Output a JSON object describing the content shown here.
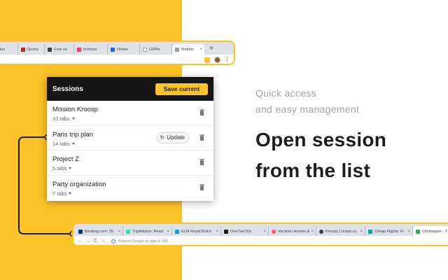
{
  "top_browser": {
    "tabs": [
      {
        "label": "dun",
        "fav_color": "#d9d9d9"
      },
      {
        "label": "Quora",
        "fav_color": "#b92b27"
      },
      {
        "label": "Free ve",
        "fav_color": "#3c4043"
      },
      {
        "label": "InVision",
        "fav_color": "#ff3366"
      },
      {
        "label": "Online",
        "fav_color": "#2b62d9"
      },
      {
        "label": "UXPin",
        "fav_color": "#9aa0a6"
      },
      {
        "label": "Mobbin",
        "fav_color": "#9aa0a6"
      }
    ],
    "new_tab_label": "+",
    "menu_glyph": "⋮"
  },
  "popup": {
    "title": "Sessions",
    "save_label": "Save current",
    "update_label": "Update",
    "sessions": [
      {
        "name": "Mission Kroosp",
        "tabs": "10 tabs"
      },
      {
        "name": "Paris trip plan",
        "tabs": "14 tabs"
      },
      {
        "name": "Project Z",
        "tabs": "5 tabs"
      },
      {
        "name": "Party organization",
        "tabs": "7 tabs"
      }
    ]
  },
  "hero": {
    "subtitle_line1": "Quick access",
    "subtitle_line2": "and easy management",
    "heading_line1": "Open session",
    "heading_line2": "from the list"
  },
  "bottom_browser": {
    "tabs": [
      {
        "label": "Booking.com: 25",
        "fav_color": "#003580"
      },
      {
        "label": "TripAdvisor: Read",
        "fav_color": "#34e0a1"
      },
      {
        "label": "KLM Royal Dutch",
        "fav_color": "#00a1de"
      },
      {
        "label": "OneTwoTrip",
        "fav_color": "#1a1a1a"
      },
      {
        "label": "Vacation Homes &",
        "fav_color": "#ff5a5f"
      },
      {
        "label": "Kroosp | Urban ca",
        "fav_color": "#3c4043"
      },
      {
        "label": "Cheap Flights: Fi",
        "fav_color": "#00a698"
      },
      {
        "label": "Citymapper - T",
        "fav_color": "#34a853"
      }
    ],
    "omnibox_placeholder": "Search Google or type a URL",
    "nav": {
      "back": "←",
      "forward": "→",
      "reload": "C",
      "home": "⌂"
    }
  },
  "colors": {
    "accent": "#FDC228",
    "header_bg": "#161616"
  }
}
